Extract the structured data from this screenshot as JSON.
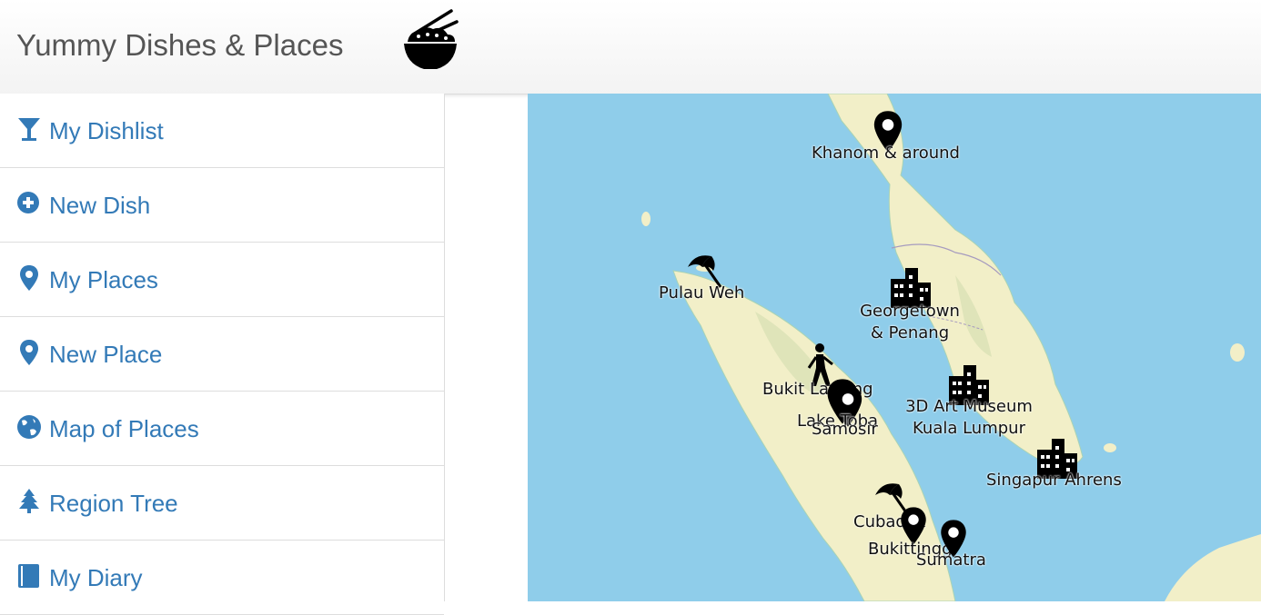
{
  "header": {
    "title": "Yummy Dishes & Places",
    "logo_icon": "rice-bowl-chopsticks-icon"
  },
  "sidebar": {
    "link_color": "#337ab7",
    "items": [
      {
        "label": "My Dishlist",
        "icon": "cocktail-glass-icon"
      },
      {
        "label": "New Dish",
        "icon": "plus-circle-icon"
      },
      {
        "label": "My Places",
        "icon": "map-marker-icon"
      },
      {
        "label": "New Place",
        "icon": "map-marker-icon"
      },
      {
        "label": "Map of Places",
        "icon": "globe-icon"
      },
      {
        "label": "Region Tree",
        "icon": "tree-icon"
      },
      {
        "label": "My Diary",
        "icon": "book-icon"
      }
    ]
  },
  "map": {
    "water_color": "#8fcdea",
    "land_color": "#f2efc8",
    "places": [
      {
        "label": "Khanom & around",
        "icon": "map-marker-icon"
      },
      {
        "label": "Pulau Weh",
        "icon": "beach-umbrella-icon"
      },
      {
        "label": "Georgetown\n& Penang",
        "icon": "city-buildings-icon"
      },
      {
        "label": "Bukit Lawang",
        "icon": "hiking-person-icon"
      },
      {
        "label": "Lake Toba",
        "icon": "map-marker-icon"
      },
      {
        "label": "Samosir",
        "icon": "map-marker-icon"
      },
      {
        "label": "3D Art Museum\nKuala Lumpur",
        "icon": "city-buildings-icon"
      },
      {
        "label": "Singapur Ahrens",
        "icon": "city-buildings-icon"
      },
      {
        "label": "Cubadak",
        "icon": "beach-umbrella-icon"
      },
      {
        "label": "Bukittinggi",
        "icon": "map-marker-icon"
      },
      {
        "label": "Sumatra",
        "icon": "map-marker-icon"
      }
    ]
  }
}
